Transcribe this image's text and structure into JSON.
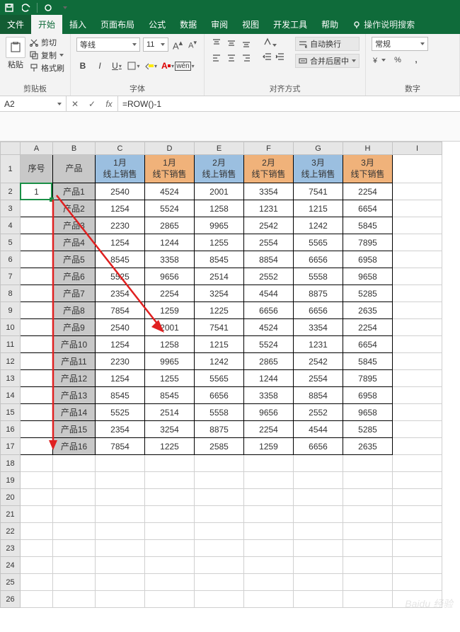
{
  "titlebar": {
    "save_tip": "保存",
    "undo_tip": "撤销",
    "redo_tip": "触摸/鼠标模式"
  },
  "tabs": {
    "file": "文件",
    "home": "开始",
    "insert": "插入",
    "layout": "页面布局",
    "formulas": "公式",
    "data": "数据",
    "review": "审阅",
    "view": "视图",
    "dev": "开发工具",
    "help": "帮助",
    "tell": "操作说明搜索"
  },
  "ribbon": {
    "clipboard": {
      "label": "剪贴板",
      "paste": "粘贴",
      "cut": "剪切",
      "copy": "复制",
      "format": "格式刷"
    },
    "font": {
      "label": "字体",
      "name": "等线",
      "size": "11",
      "bold": "B",
      "italic": "I",
      "underline": "U",
      "increase": "A",
      "decrease": "A"
    },
    "align": {
      "label": "对齐方式",
      "wrap": "自动换行",
      "merge": "合并后居中"
    },
    "number": {
      "label": "数字",
      "format": "常规",
      "percent": "%",
      "comma": ","
    }
  },
  "fbar": {
    "name": "A2",
    "formula": "=ROW()-1"
  },
  "columns": [
    "A",
    "B",
    "C",
    "D",
    "E",
    "F",
    "G",
    "H",
    "I"
  ],
  "header_row_labels": {
    "seq": "序号",
    "prod": "产品",
    "c": "1月\n线上销售",
    "d": "1月\n线下销售",
    "e": "2月\n线上销售",
    "f": "2月\n线下销售",
    "g": "3月\n线上销售",
    "h": "3月\n线下销售"
  },
  "data_rows": [
    {
      "r": 2,
      "seq": "1",
      "prod": "产品1",
      "v": [
        2540,
        4524,
        2001,
        3354,
        7541,
        2254
      ]
    },
    {
      "r": 3,
      "seq": "",
      "prod": "产品2",
      "v": [
        1254,
        5524,
        1258,
        1231,
        1215,
        6654
      ]
    },
    {
      "r": 4,
      "seq": "",
      "prod": "产品3",
      "v": [
        2230,
        2865,
        9965,
        2542,
        1242,
        5845
      ]
    },
    {
      "r": 5,
      "seq": "",
      "prod": "产品4",
      "v": [
        1254,
        1244,
        1255,
        2554,
        5565,
        7895
      ]
    },
    {
      "r": 6,
      "seq": "",
      "prod": "产品5",
      "v": [
        8545,
        3358,
        8545,
        8854,
        6656,
        6958
      ]
    },
    {
      "r": 7,
      "seq": "",
      "prod": "产品6",
      "v": [
        5525,
        9656,
        2514,
        2552,
        5558,
        9658
      ]
    },
    {
      "r": 8,
      "seq": "",
      "prod": "产品7",
      "v": [
        2354,
        2254,
        3254,
        4544,
        8875,
        5285
      ]
    },
    {
      "r": 9,
      "seq": "",
      "prod": "产品8",
      "v": [
        7854,
        1259,
        1225,
        6656,
        6656,
        2635
      ]
    },
    {
      "r": 10,
      "seq": "",
      "prod": "产品9",
      "v": [
        2540,
        2001,
        7541,
        4524,
        3354,
        2254
      ]
    },
    {
      "r": 11,
      "seq": "",
      "prod": "产品10",
      "v": [
        1254,
        1258,
        1215,
        5524,
        1231,
        6654
      ]
    },
    {
      "r": 12,
      "seq": "",
      "prod": "产品11",
      "v": [
        2230,
        9965,
        1242,
        2865,
        2542,
        5845
      ]
    },
    {
      "r": 13,
      "seq": "",
      "prod": "产品12",
      "v": [
        1254,
        1255,
        5565,
        1244,
        2554,
        7895
      ]
    },
    {
      "r": 14,
      "seq": "",
      "prod": "产品13",
      "v": [
        8545,
        8545,
        6656,
        3358,
        8854,
        6958
      ]
    },
    {
      "r": 15,
      "seq": "",
      "prod": "产品14",
      "v": [
        5525,
        2514,
        5558,
        9656,
        2552,
        9658
      ]
    },
    {
      "r": 16,
      "seq": "",
      "prod": "产品15",
      "v": [
        2354,
        3254,
        8875,
        2254,
        4544,
        5285
      ]
    },
    {
      "r": 17,
      "seq": "",
      "prod": "产品16",
      "v": [
        7854,
        1225,
        2585,
        1259,
        6656,
        2635
      ]
    }
  ],
  "empty_rows": [
    18,
    19,
    20,
    21,
    22,
    23,
    24,
    25,
    26
  ],
  "watermark": "Baidu 经验"
}
